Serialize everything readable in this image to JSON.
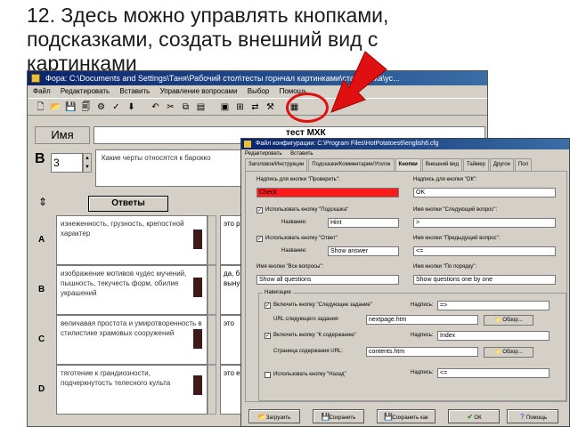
{
  "slide": {
    "title_lines": [
      "12. Здесь можно управлять кнопками,",
      "подсказками, создать внешний вид с",
      "картинками"
    ]
  },
  "main_window": {
    "title": "Фора: C:\\Documents and Settings\\Таня\\Рабочий стол\\тесты горнчал картинками\\статистика\\ус...",
    "menu": [
      "Файл",
      "Редактировать",
      "Вставить",
      "Управление вопросами",
      "Выбор",
      "Помощь"
    ],
    "name_label": "Имя",
    "test_label": "тест МХК",
    "question_letter": "В",
    "question_number": "3",
    "question_text": "Какие черты относятся к барокко",
    "answers_button": "Ответы",
    "answers": [
      {
        "letter": "A",
        "text": "изнеженность, грузность, крепостной характер",
        "right": "это р"
      },
      {
        "letter": "B",
        "text": "изображение мотивов чудес мучений, пышность, текучесть форм, обилие украшений",
        "right": "да, б выну"
      },
      {
        "letter": "C",
        "text": "величавая простота и умиротворенность в стилистике храмовых сооружений",
        "right": "это"
      },
      {
        "letter": "D",
        "text": "тяготение к грандиозности, подчеркнутость телесного культа",
        "right": "это е"
      }
    ]
  },
  "dialog": {
    "title": "Файл конфигурации: C:\\Program Files\\HotPotatoes6\\english6.cfg",
    "menu": [
      "Редактировать",
      "Вставить"
    ],
    "tabs": [
      "Заголовок/Инструкции",
      "Подсказки/Комментарии/Уголок",
      "Кнопки",
      "Внешний вид",
      "Таймер",
      "Другое",
      "Пол"
    ],
    "active_tab": "Кнопки",
    "check_label": "Надпись для кнопки \"Проверить\":",
    "check_value": "Check",
    "ok_label": "Надпись для кнопки \"ОК\":",
    "ok_value": "OK",
    "use_hint_label": "Использовать кнопку \"Подсказка\"",
    "hint_caption_label": "Название:",
    "hint_value": "Hint",
    "use_answer_label": "Использовать кнопку \"Ответ\"",
    "answer_caption_label": "Название:",
    "answer_value": "Show answer",
    "next_q_label": "Имя кнопки \"Следующий вопрос\":",
    "next_q_value": ">",
    "prev_q_label": "Имя кнопки \"Предыдущий вопрос\":",
    "prev_q_value": "<=",
    "all_q_label": "Имя кнопки \"Все вопросы\":",
    "all_q_value": "Show all questions",
    "one_by_one_label": "Имя кнопки \"По порядку\":",
    "one_by_one_value": "Show questions one by one",
    "nav_title": "Навигация",
    "next_ex_label": "Включить кнопку \"Следующее задание\"",
    "next_ex_caption": "Надпись:",
    "next_ex_value": "=>",
    "next_ex_url_label": "URL следующего задания:",
    "next_ex_url_value": "nextpage.htm",
    "browse1": "Обзор...",
    "contents_label": "Включить кнопку \"К содержанию\"",
    "contents_caption": "Надпись:",
    "contents_value": "Index",
    "contents_url_label": "Страница содержания URL:",
    "contents_url_value": "contents.htm",
    "browse2": "Обзор...",
    "back_label": "Использовать кнопку \"Назад\"",
    "back_caption": "Надпись:",
    "back_value": "<=",
    "buttons": {
      "load": "Загрузить",
      "save": "Сохранить",
      "save_as": "Сохранить как",
      "ok": "ОК",
      "help": "Помощь"
    }
  },
  "colors": {
    "annotation_red": "#e01010",
    "titlebar": "#0a246a",
    "check_field": "#ff1a1a"
  }
}
